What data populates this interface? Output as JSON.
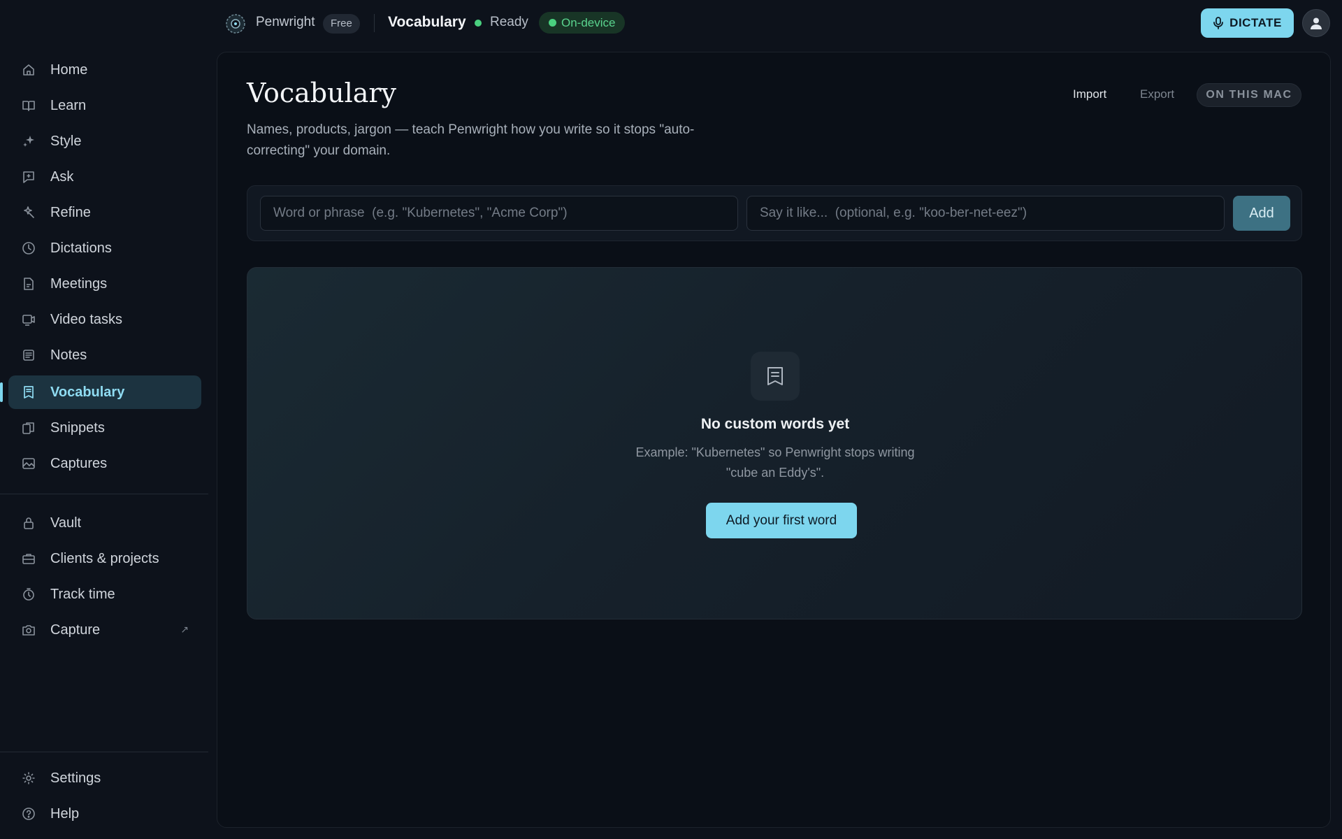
{
  "topbar": {
    "brand_name": "Penwright",
    "plan": "Free",
    "page_title": "Vocabulary",
    "status": "Ready",
    "processing_mode": "On-device",
    "dictate_label": "DICTATE"
  },
  "sidebar": {
    "items": [
      {
        "label": "Home",
        "icon": "home-icon"
      },
      {
        "label": "Learn",
        "icon": "book-icon"
      },
      {
        "label": "Style",
        "icon": "sparkle-icon"
      },
      {
        "label": "Ask",
        "icon": "chat-icon"
      },
      {
        "label": "Refine",
        "icon": "magic-icon"
      },
      {
        "label": "Dictations",
        "icon": "clock-icon"
      },
      {
        "label": "Meetings",
        "icon": "document-icon"
      },
      {
        "label": "Video tasks",
        "icon": "video-icon"
      },
      {
        "label": "Notes",
        "icon": "notes-icon"
      },
      {
        "label": "Vocabulary",
        "icon": "vocabulary-icon",
        "active": true
      },
      {
        "label": "Snippets",
        "icon": "snippets-icon"
      },
      {
        "label": "Captures",
        "icon": "image-icon"
      }
    ],
    "secondary_items": [
      {
        "label": "Vault",
        "icon": "lock-icon"
      },
      {
        "label": "Clients & projects",
        "icon": "briefcase-icon"
      },
      {
        "label": "Track time",
        "icon": "stopwatch-icon"
      },
      {
        "label": "Capture",
        "icon": "camera-icon",
        "external_glyph": "↗"
      }
    ],
    "footer_items": [
      {
        "label": "Settings",
        "icon": "gear-icon"
      },
      {
        "label": "Help",
        "icon": "help-icon"
      }
    ]
  },
  "main": {
    "title": "Vocabulary",
    "description": "Names, products, jargon — teach Penwright how you write so it stops \"auto-correcting\" your domain.",
    "import_label": "Import",
    "export_label": "Export",
    "location_badge": "ON THIS MAC",
    "add_form": {
      "word_placeholder": "Word or phrase  (e.g. \"Kubernetes\", \"Acme Corp\")",
      "word_value": "",
      "say_placeholder": "Say it like...  (optional, e.g. \"koo-ber-net-eez\")",
      "say_value": "",
      "add_label": "Add"
    },
    "empty_state": {
      "title": "No custom words yet",
      "description": "Example: \"Kubernetes\" so Penwright stops writing \"cube an Eddy's\".",
      "cta_label": "Add your first word"
    }
  },
  "colors": {
    "accent": "#7dd6ee",
    "status_green": "#4ad07f",
    "background": "#0d121b",
    "panel": "#0a0f17"
  }
}
